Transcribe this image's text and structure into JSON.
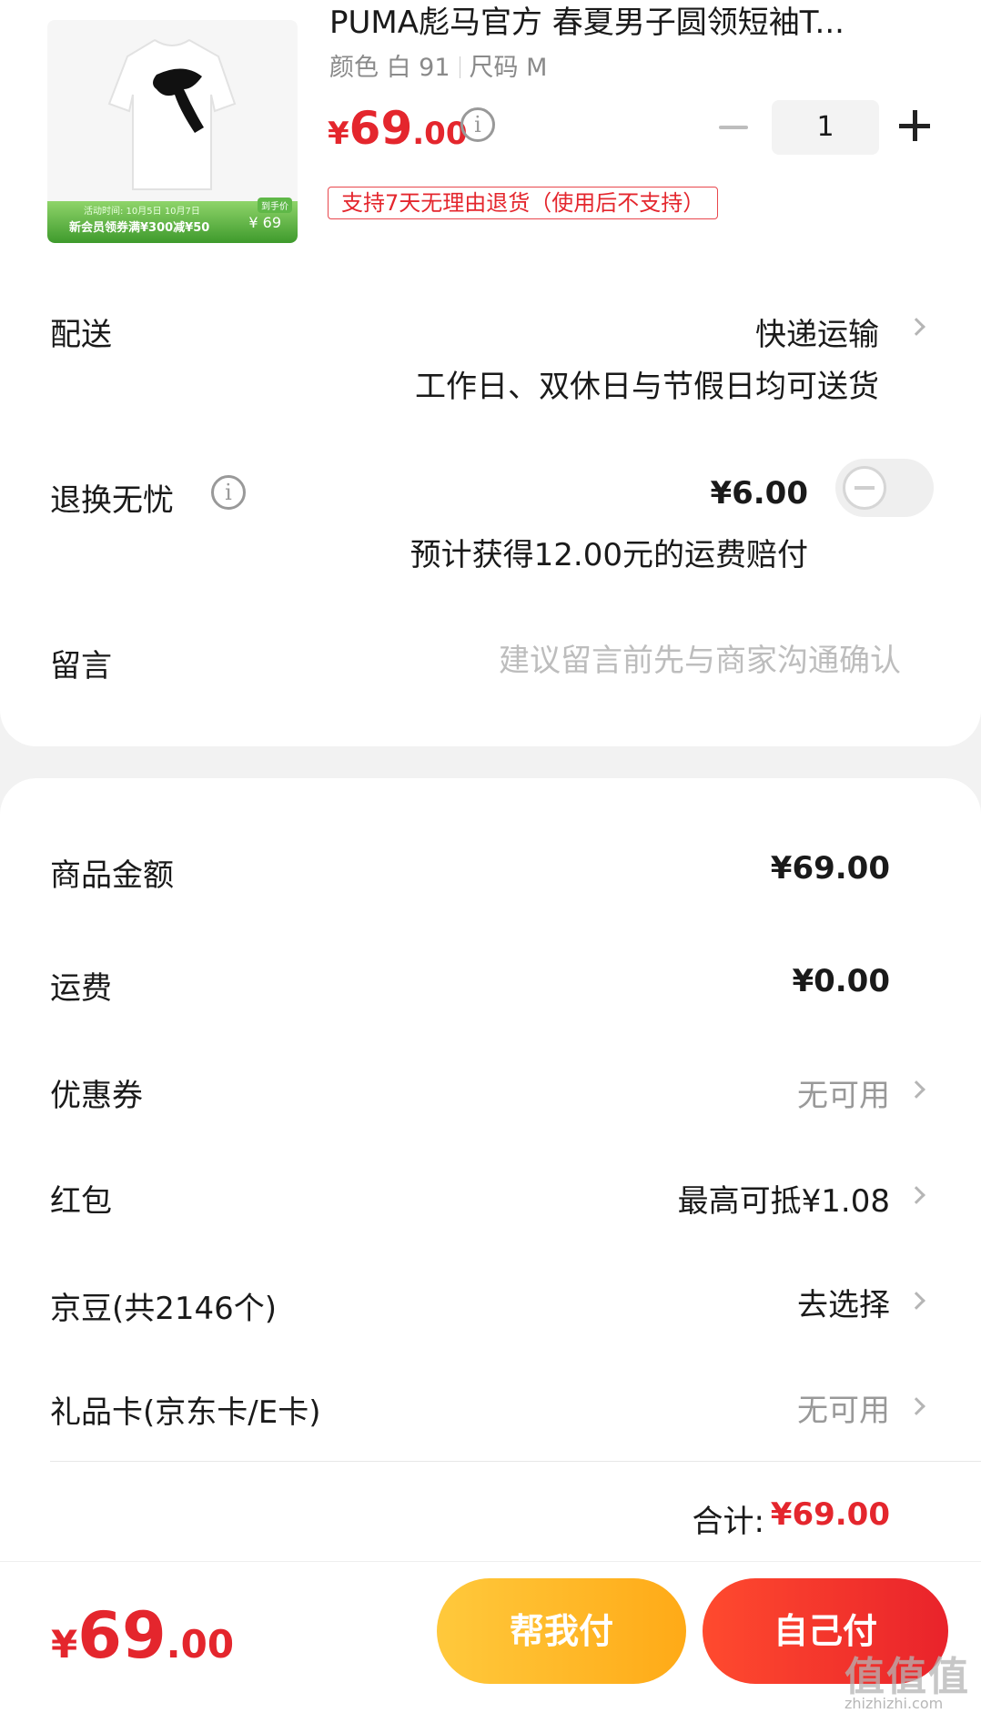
{
  "product": {
    "title": "PUMA彪马官方 春夏男子圆领短袖T...",
    "spec_color": "颜色 白 91",
    "spec_size": "尺码 M",
    "price_currency": "¥",
    "price_int": "69",
    "price_dec": ".00",
    "info_icon": "i",
    "quantity": "1",
    "return_policy": "支持7天无理由退货（使用后不支持）",
    "promo": {
      "date": "活动时间: 10月5日 10月7日",
      "text": "新会员领券满¥300减¥50",
      "price": "¥ 69",
      "tag": "到手价"
    }
  },
  "delivery": {
    "label": "配送",
    "method": "快递运输",
    "note": "工作日、双休日与节假日均可送货"
  },
  "return_insurance": {
    "label": "退换无忧",
    "info_icon": "i",
    "price": "¥6.00",
    "note": "预计获得12.00元的运费赔付",
    "enabled": false
  },
  "message": {
    "label": "留言",
    "placeholder": "建议留言前先与商家沟通确认"
  },
  "summary": {
    "goods_label": "商品金额",
    "goods_value": "¥69.00",
    "shipping_label": "运费",
    "shipping_value": "¥0.00",
    "coupon_label": "优惠券",
    "coupon_value": "无可用",
    "redpacket_label": "红包",
    "redpacket_value": "最高可抵¥1.08",
    "jingdou_label": "京豆(共2146个)",
    "jingdou_value": "去选择",
    "giftcard_label": "礼品卡(京东卡/E卡)",
    "giftcard_value": "无可用",
    "total_label": "合计:",
    "total_value": "¥69.00"
  },
  "bottom": {
    "price_currency": "¥",
    "price_int": "69",
    "price_dec": ".00",
    "help_pay": "帮我付",
    "self_pay": "自己付"
  },
  "watermark": {
    "text": "值值值",
    "url": "zhizhizhi.com"
  },
  "colors": {
    "accent_red": "#e4262d",
    "help_btn": "#ffb020",
    "background": "#f2f2f2"
  }
}
